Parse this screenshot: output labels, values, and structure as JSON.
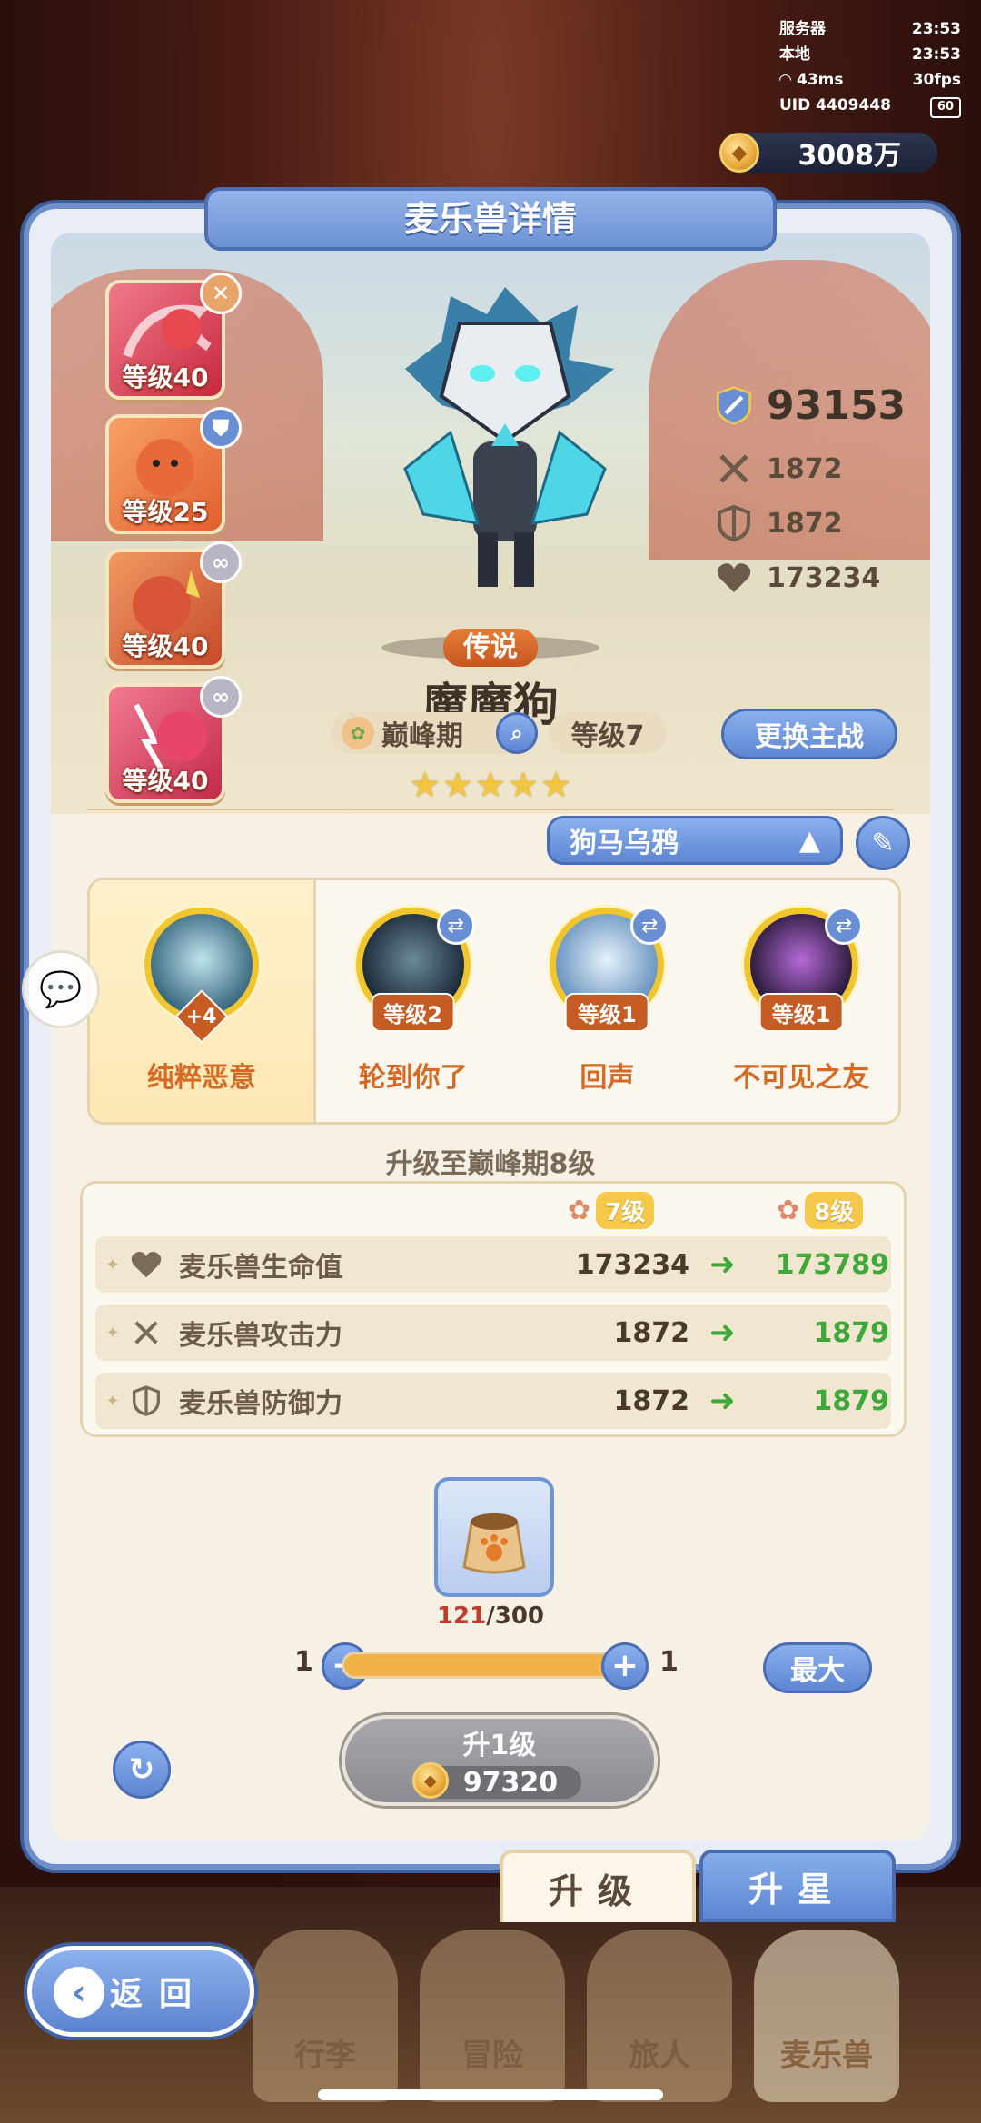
{
  "status": {
    "server_label": "服务器",
    "server_time": "23:53",
    "local_label": "本地",
    "local_time": "23:53",
    "ping": "43ms",
    "fps": "30fps",
    "uid": "UID 4409448",
    "battery": "60"
  },
  "currency": {
    "gold": "3008万"
  },
  "panel": {
    "title": "麦乐兽详情"
  },
  "team_cards": [
    {
      "level": "等级40",
      "badge_icon": "sword-cross-icon",
      "color": "#e8455a"
    },
    {
      "level": "等级25",
      "badge_icon": "shield-icon",
      "color": "#e9753f"
    },
    {
      "level": "等级40",
      "badge_icon": "link-icon",
      "color": "#d9553a"
    },
    {
      "level": "等级40",
      "badge_icon": "link-icon",
      "color": "#e8456a"
    }
  ],
  "monster": {
    "rarity": "传说",
    "name": "魔魔狗",
    "stage": "巅峰期",
    "level": "等级7",
    "stars": 5,
    "power": "93153",
    "attack": "1872",
    "defense": "1872",
    "hp": "173234"
  },
  "actions": {
    "change_main": "更换主战",
    "team_name": "狗马乌鸦"
  },
  "skills": [
    {
      "name": "纯粹恶意",
      "tag": "+4",
      "orb_color": "#6fb8c9"
    },
    {
      "name": "轮到你了",
      "tag": "等级2",
      "orb_color": "#3d5a6a"
    },
    {
      "name": "回声",
      "tag": "等级1",
      "orb_color": "#8fb7dc"
    },
    {
      "name": "不可见之友",
      "tag": "等级1",
      "orb_color": "#5a3a7a"
    }
  ],
  "upgrade": {
    "title": "升级至巅峰期8级",
    "from_level": "7级",
    "to_level": "8级",
    "rows": [
      {
        "label": "麦乐兽生命值",
        "icon": "heart-icon",
        "current": "173234",
        "next": "173789"
      },
      {
        "label": "麦乐兽攻击力",
        "icon": "swords-icon",
        "current": "1872",
        "next": "1879"
      },
      {
        "label": "麦乐兽防御力",
        "icon": "shield-icon",
        "current": "1872",
        "next": "1879"
      }
    ]
  },
  "material": {
    "have": "121",
    "need": "/300",
    "icon": "paw-food-bag-icon"
  },
  "slider": {
    "min": "1",
    "max": "1",
    "max_button": "最大"
  },
  "level_up": {
    "label": "升1级",
    "cost": "97320"
  },
  "tabs": {
    "upgrade": "升级",
    "star": "升星"
  },
  "nav": {
    "back": "返回",
    "items": [
      "行李",
      "冒险",
      "旅人",
      "麦乐兽"
    ]
  },
  "colors": {
    "accent_blue": "#6e92d3",
    "gain_green": "#3ea83a",
    "gold": "#f5c84a"
  }
}
